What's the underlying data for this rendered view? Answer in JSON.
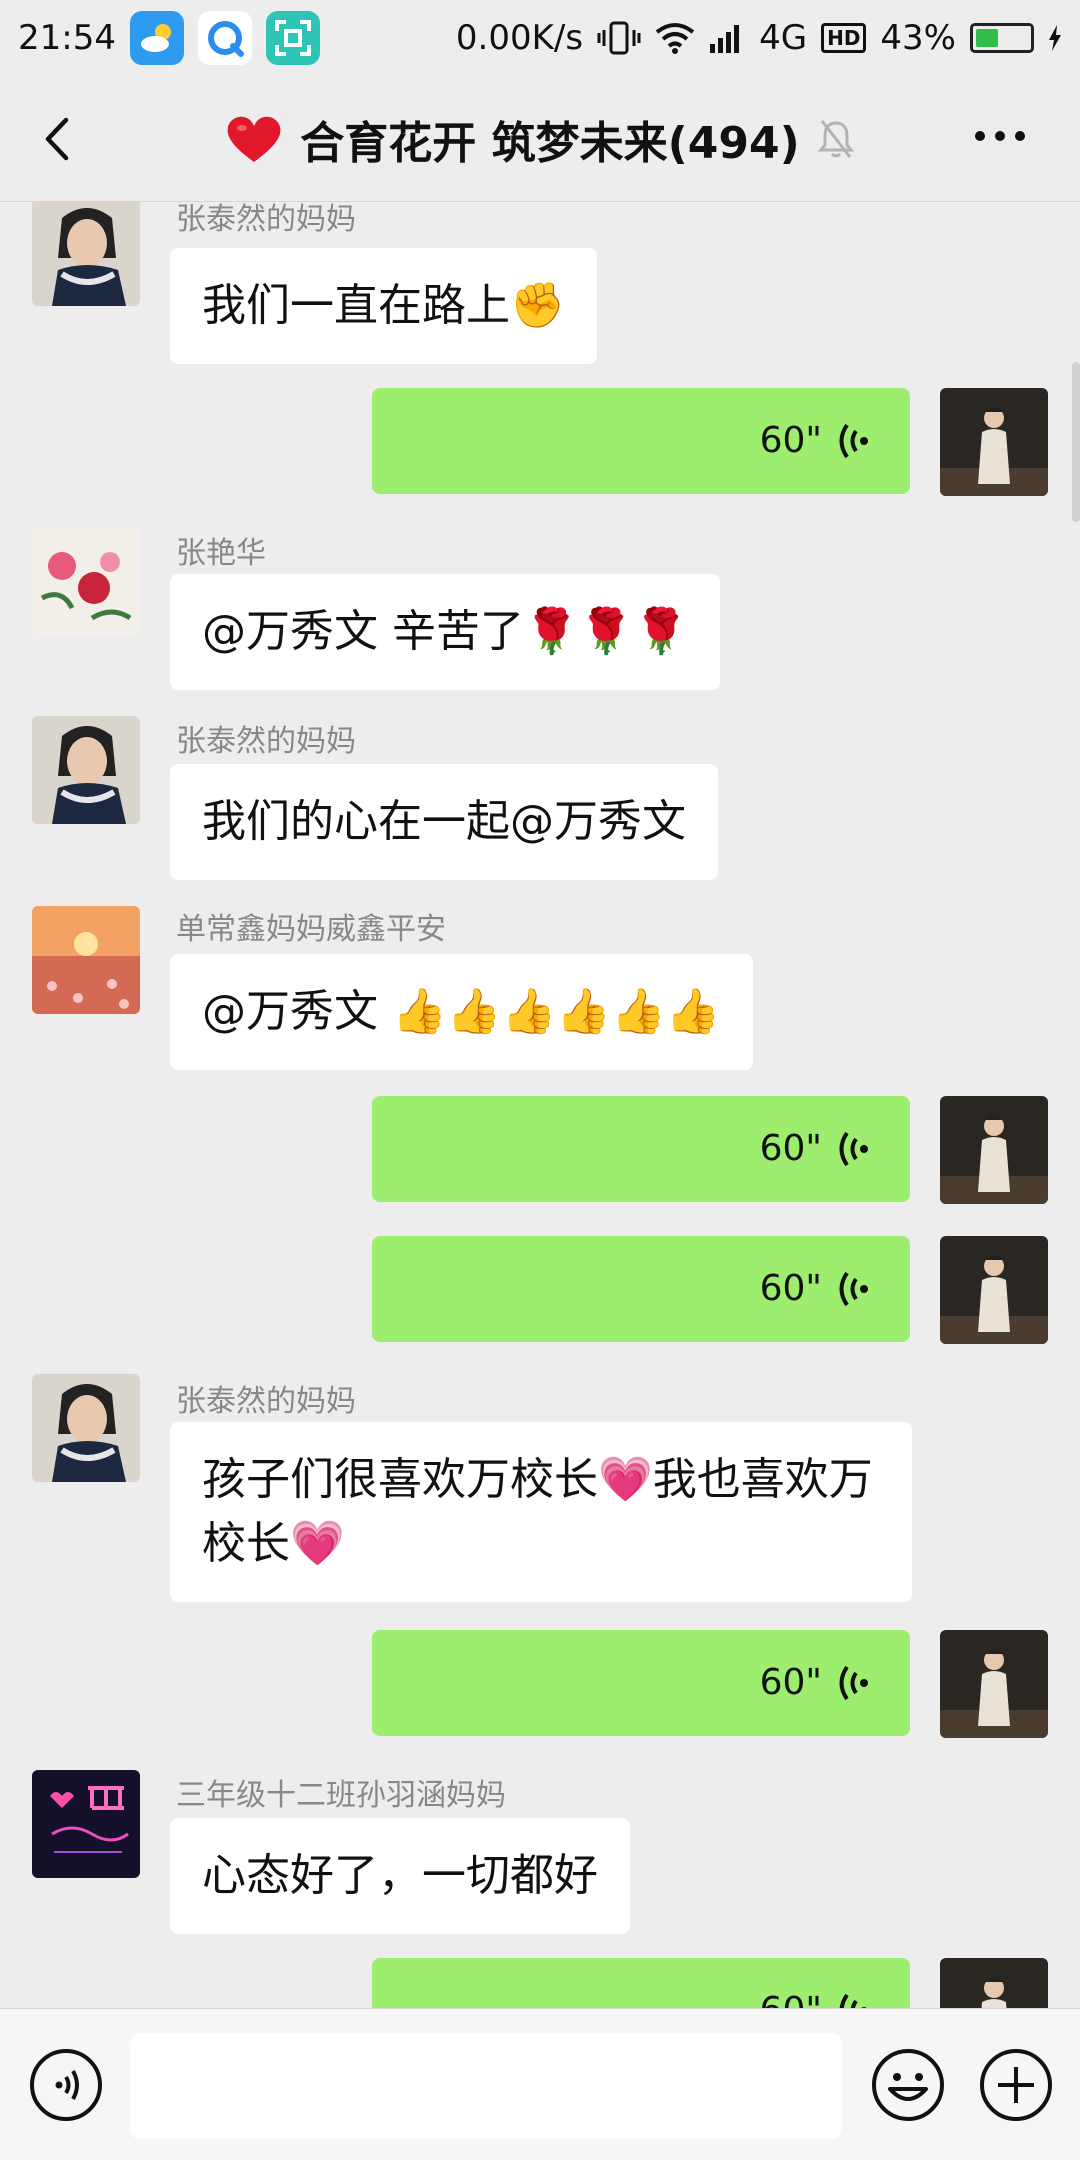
{
  "status": {
    "time": "21:54",
    "speed": "0.00K/s",
    "network": "4G",
    "hd": "HD",
    "battery_pct": "43%",
    "battery_level": 0.43
  },
  "header": {
    "title": "合育花开 筑梦未来(494)"
  },
  "messages": {
    "m1": {
      "sender": "张泰然的妈妈",
      "text": "我们一直在路上✊"
    },
    "m2": {
      "duration": "60\""
    },
    "m3": {
      "sender": "张艳华",
      "text": "@万秀文  辛苦了🌹🌹🌹"
    },
    "m4": {
      "sender": "张泰然的妈妈",
      "text": "我们的心在一起@万秀文"
    },
    "m5": {
      "sender": "单常鑫妈妈威鑫平安",
      "text": "@万秀文 👍👍👍👍👍👍"
    },
    "m6": {
      "duration": "60\""
    },
    "m7": {
      "duration": "60\""
    },
    "m8": {
      "sender": "张泰然的妈妈",
      "text": "孩子们很喜欢万校长💗我也喜欢万校长💗"
    },
    "m9": {
      "duration": "60\""
    },
    "m10": {
      "sender": "三年级十二班孙羽涵妈妈",
      "text": "心态好了，一切都好"
    },
    "m11": {
      "duration": "60\""
    }
  },
  "colors": {
    "bg": "#ededed",
    "out_bubble": "#9ded6e",
    "in_bubble": "#ffffff",
    "name_gray": "#888888"
  },
  "icons": [
    "cloud-weather-icon",
    "search-app-icon",
    "scan-icon",
    "vibrate-icon",
    "wifi-icon",
    "signal-icon",
    "battery-icon",
    "back-icon",
    "heart-icon",
    "mute-bell-icon",
    "more-icon",
    "voice-wave-icon",
    "voice-input-icon",
    "emoji-icon",
    "plus-icon"
  ]
}
